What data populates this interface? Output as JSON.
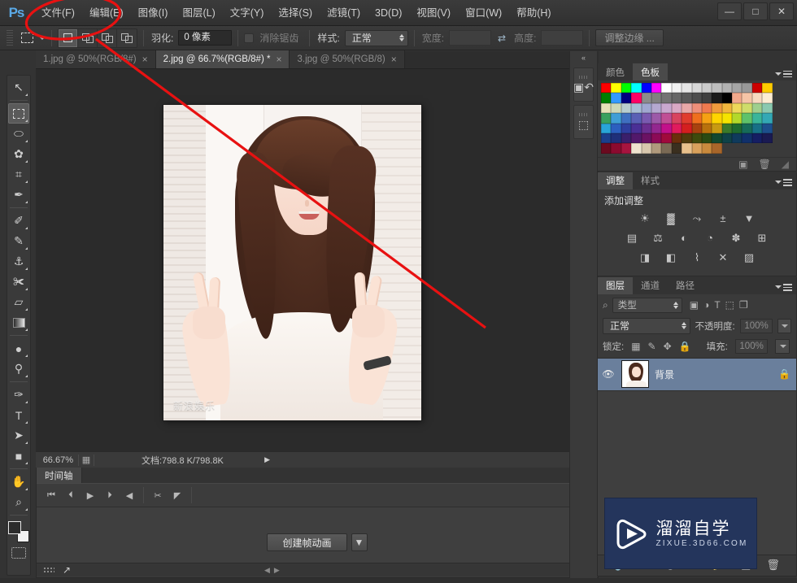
{
  "app": {
    "logo": "Ps",
    "menus": [
      {
        "label": "文件(F)"
      },
      {
        "label": "编辑(E)"
      },
      {
        "label": "图像(I)"
      },
      {
        "label": "图层(L)"
      },
      {
        "label": "文字(Y)"
      },
      {
        "label": "选择(S)"
      },
      {
        "label": "滤镜(T)"
      },
      {
        "label": "3D(D)"
      },
      {
        "label": "视图(V)"
      },
      {
        "label": "窗口(W)"
      },
      {
        "label": "帮助(H)"
      }
    ],
    "window_controls": {
      "minimize": "—",
      "maximize": "□",
      "close": "✕"
    }
  },
  "options_bar": {
    "tool_preset_icon": "rectangular-marquee-icon",
    "selection_modes": [
      {
        "name": "new-selection",
        "active": true
      },
      {
        "name": "add-to-selection",
        "active": false
      },
      {
        "name": "subtract-from-selection",
        "active": false
      },
      {
        "name": "intersect-selection",
        "active": false
      }
    ],
    "feather_label": "羽化:",
    "feather_value": "0 像素",
    "antialias_label": "消除锯齿",
    "style_label": "样式:",
    "style_value": "正常",
    "width_label": "宽度:",
    "width_value": "",
    "swap_icon": "swap-arrows-icon",
    "height_label": "高度:",
    "height_value": "",
    "refine_edge_label": "调整边缘 ..."
  },
  "toolbar": {
    "tools": [
      {
        "name": "move-tool",
        "glyph": "↖",
        "active": false
      },
      {
        "name": "rectangular-marquee-tool",
        "glyph": "marquee",
        "active": true
      },
      {
        "name": "lasso-tool",
        "glyph": "⬭",
        "active": false
      },
      {
        "name": "quick-selection-tool",
        "glyph": "✿",
        "active": false
      },
      {
        "name": "crop-tool",
        "glyph": "⌗",
        "active": false
      },
      {
        "name": "eyedropper-tool",
        "glyph": "✒",
        "active": false
      },
      {
        "name": "spot-healing-brush-tool",
        "glyph": "✐",
        "active": false
      },
      {
        "name": "brush-tool",
        "glyph": "✎",
        "active": false
      },
      {
        "name": "clone-stamp-tool",
        "glyph": "⚓",
        "active": false
      },
      {
        "name": "history-brush-tool",
        "glyph": "✀",
        "active": false
      },
      {
        "name": "eraser-tool",
        "glyph": "▱",
        "active": false
      },
      {
        "name": "gradient-tool",
        "glyph": "gradient",
        "active": false
      },
      {
        "name": "blur-tool",
        "glyph": "●",
        "active": false
      },
      {
        "name": "dodge-tool",
        "glyph": "⚲",
        "active": false
      },
      {
        "name": "pen-tool",
        "glyph": "✑",
        "active": false
      },
      {
        "name": "type-tool",
        "glyph": "T",
        "active": false
      },
      {
        "name": "path-selection-tool",
        "glyph": "➤",
        "active": false
      },
      {
        "name": "rectangle-tool",
        "glyph": "■",
        "active": false
      },
      {
        "name": "hand-tool",
        "glyph": "✋",
        "active": false
      },
      {
        "name": "zoom-tool",
        "glyph": "⌕",
        "active": false
      }
    ],
    "foreground_color": "#2c2c2c",
    "background_color": "#f2f2f2",
    "quick_mask_name": "quick-mask-toggle"
  },
  "document_tabs": [
    {
      "label": "1.jpg @ 50%(RGB/8#)",
      "active": false,
      "close": "×"
    },
    {
      "label": "2.jpg @ 66.7%(RGB/8#) *",
      "active": true,
      "close": "×"
    },
    {
      "label": "3.jpg @ 50%(RGB/8)",
      "active": false,
      "close": "×"
    }
  ],
  "canvas": {
    "image_watermark": "新浪娱乐"
  },
  "status_bar": {
    "zoom": "66.67%",
    "preview_icon": "document-thumb-icon",
    "doc_info": "文档:798.8 K/798.8K",
    "arrow": "▶"
  },
  "timeline": {
    "tab_label": "时间轴",
    "controls": [
      {
        "name": "first-frame-button",
        "glyph": "⏮"
      },
      {
        "name": "previous-frame-button",
        "glyph": "⏴"
      },
      {
        "name": "play-button",
        "glyph": "▶"
      },
      {
        "name": "next-frame-button",
        "glyph": "⏵"
      },
      {
        "name": "audio-button",
        "glyph": "◀"
      },
      {
        "name": "split-clip-button",
        "glyph": "✂"
      },
      {
        "name": "transition-button",
        "glyph": "◤"
      }
    ],
    "create_animation_label": "创建帧动画",
    "create_dropdown_glyph": "▼"
  },
  "collapsed_dock": {
    "collapse_glyph": "«",
    "items": [
      {
        "name": "history-panel-icon",
        "glyph": "↺"
      },
      {
        "name": "mini-bridge-panel-icon",
        "glyph": "⬚"
      }
    ]
  },
  "panels": {
    "color": {
      "tabs": [
        {
          "label": "颜色",
          "active": false
        },
        {
          "label": "色板",
          "active": true
        }
      ],
      "swatch_rows": [
        [
          "#ff0000",
          "#ffff00",
          "#00ff00",
          "#00ffff",
          "#0000ff",
          "#ff00ff",
          "#ffffff",
          "#f2f2f2",
          "#e6e6e6",
          "#d9d9d9",
          "#cccccc",
          "#bfbfbf",
          "#b3b3b3",
          "#a6a6a6",
          "#999999",
          "#cc0000",
          "#ffcc00"
        ],
        [
          "#008000",
          "#3399ff",
          "#000080",
          "#ff0066",
          "#8c8c8c",
          "#808080",
          "#737373",
          "#666666",
          "#595959",
          "#4d4d4d",
          "#404040",
          "#1a1a1a",
          "#000000",
          "#f2a98c",
          "#f5c4a6",
          "#f7d9bf",
          "#fcecd2"
        ],
        [
          "#e8e2b8",
          "#cdd8b8",
          "#b8cdd0",
          "#a8bcd6",
          "#a0a8d0",
          "#b4a8d0",
          "#c9a8cf",
          "#d9a8c4",
          "#e8a8a8",
          "#ef8f7a",
          "#f07a4f",
          "#ef9a3c",
          "#f0b63c",
          "#eed85a",
          "#cfdc6b",
          "#9fcf8e",
          "#8ac9b0"
        ],
        [
          "#3aa05e",
          "#3f9ed6",
          "#3f6fc0",
          "#5a5fb5",
          "#7a5ab0",
          "#9c59a8",
          "#c04f95",
          "#d8435f",
          "#e03c2e",
          "#ef6f1e",
          "#f5a114",
          "#ffd400",
          "#f5e400",
          "#b3d92a",
          "#5ec26a",
          "#39b59a",
          "#33a8b5"
        ],
        [
          "#29a5d8",
          "#2c5fbf",
          "#2f3e9e",
          "#4a2f96",
          "#6b2f90",
          "#93278f",
          "#c2108a",
          "#e01b5d",
          "#d41f1f",
          "#a8420f",
          "#b8710d",
          "#c89a12",
          "#3a7a2a",
          "#1f6b2f",
          "#166b59",
          "#176f86",
          "#1d4f8c"
        ],
        [
          "#1b3f8c",
          "#1f2f7a",
          "#3a1f6b",
          "#52186b",
          "#6b1263",
          "#8c0a57",
          "#a00a3c",
          "#6b2f0c",
          "#4f3b0c",
          "#3f4a0c",
          "#2a4a12",
          "#12482f",
          "#0f4248",
          "#0f3a5c",
          "#10306b",
          "#151e63",
          "#1a1a52"
        ],
        [
          "#6b0a1f",
          "#8c0a2f",
          "#a8143f",
          "#efe3cf",
          "#d8c7ad",
          "#b09a7d",
          "#7a6a55",
          "#3a2f1f",
          "#e8c08c",
          "#d9a15c",
          "#c98a3d",
          "#a8662a",
          "",
          "",
          "",
          "",
          ""
        ]
      ],
      "footer_icons": [
        {
          "name": "new-swatch-icon",
          "glyph": "▣"
        },
        {
          "name": "delete-swatch-icon",
          "glyph": "🗑"
        }
      ]
    },
    "adjustments": {
      "tabs": [
        {
          "label": "调整",
          "active": true
        },
        {
          "label": "样式",
          "active": false
        }
      ],
      "title": "添加调整",
      "rows": [
        [
          {
            "name": "brightness-contrast-icon",
            "glyph": "☀"
          },
          {
            "name": "levels-icon",
            "glyph": "▓"
          },
          {
            "name": "curves-icon",
            "glyph": "⤳"
          },
          {
            "name": "exposure-icon",
            "glyph": "±"
          },
          {
            "name": "vibrance-icon",
            "glyph": "▼"
          }
        ],
        [
          {
            "name": "hue-saturation-icon",
            "glyph": "▤"
          },
          {
            "name": "color-balance-icon",
            "glyph": "⚖"
          },
          {
            "name": "black-white-icon",
            "glyph": "◐"
          },
          {
            "name": "photo-filter-icon",
            "glyph": "◔"
          },
          {
            "name": "channel-mixer-icon",
            "glyph": "✽"
          },
          {
            "name": "color-lookup-icon",
            "glyph": "⊞"
          }
        ],
        [
          {
            "name": "invert-icon",
            "glyph": "◨"
          },
          {
            "name": "posterize-icon",
            "glyph": "◧"
          },
          {
            "name": "threshold-icon",
            "glyph": "⌇"
          },
          {
            "name": "gradient-map-icon",
            "glyph": "✕"
          },
          {
            "name": "selective-color-icon",
            "glyph": "▨"
          }
        ]
      ],
      "top_icons": [
        {
          "name": "new-adjustment-icon",
          "glyph": "◨"
        },
        {
          "name": "delete-adjustment-icon",
          "glyph": "🗑"
        },
        {
          "name": "resize-grip-icon",
          "glyph": "◢"
        }
      ]
    },
    "layers": {
      "tabs": [
        {
          "label": "图层",
          "active": true
        },
        {
          "label": "通道",
          "active": false
        },
        {
          "label": "路径",
          "active": false
        }
      ],
      "filter_label": "类型",
      "filter_icons": [
        {
          "name": "filter-pixel-icon",
          "glyph": "▣"
        },
        {
          "name": "filter-adjustment-icon",
          "glyph": "◑"
        },
        {
          "name": "filter-type-icon",
          "glyph": "T"
        },
        {
          "name": "filter-shape-icon",
          "glyph": "⬚"
        },
        {
          "name": "filter-smart-object-icon",
          "glyph": "❐"
        }
      ],
      "blend_mode": "正常",
      "opacity_label": "不透明度:",
      "opacity_value": "100%",
      "lock_label": "锁定:",
      "lock_icons": [
        {
          "name": "lock-transparency-icon",
          "glyph": "▦"
        },
        {
          "name": "lock-image-icon",
          "glyph": "✎"
        },
        {
          "name": "lock-position-icon",
          "glyph": "✥"
        },
        {
          "name": "lock-all-icon",
          "glyph": "🔒"
        }
      ],
      "fill_label": "填充:",
      "fill_value": "100%",
      "items": [
        {
          "name": "背景",
          "visible": true,
          "locked": true
        }
      ],
      "footer_icons": [
        {
          "name": "link-layers-icon",
          "glyph": "🔗"
        },
        {
          "name": "layer-style-icon",
          "glyph": "fx"
        },
        {
          "name": "add-mask-icon",
          "glyph": "◉"
        },
        {
          "name": "new-adjustment-layer-icon",
          "glyph": "◑"
        },
        {
          "name": "new-group-icon",
          "glyph": "📁"
        },
        {
          "name": "new-layer-icon",
          "glyph": "◨"
        },
        {
          "name": "delete-layer-icon",
          "glyph": "🗑"
        }
      ]
    }
  },
  "watermark": {
    "title": "溜溜自学",
    "subtitle": "ZIXUE.3D66.COM",
    "background_color": "#24355c",
    "logo_name": "play-button-logo"
  },
  "annotations": {
    "ellipse_color": "#e81111",
    "line_color": "#e81111",
    "ellipse_target": "文件(F) 编辑(E) 菜单",
    "arrow_target": "新建选区按钮"
  }
}
